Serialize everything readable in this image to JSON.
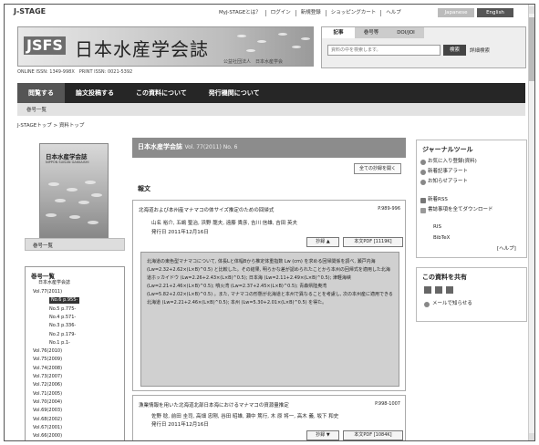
{
  "top": {
    "logo": "J-STAGE",
    "links": [
      "MyJ-STAGEとは？",
      "ログイン",
      "新規登録",
      "ショッピングカート",
      "ヘルプ"
    ],
    "lang_jp": "Japanese",
    "lang_en": "English"
  },
  "banner": {
    "abbr": "JSFS",
    "title": "日本水産学会誌",
    "subtitle": "公益社団法人　日本水産学会",
    "issn": "ONLINE ISSN: 1349-998X　PRINT ISSN: 0021-5392"
  },
  "search": {
    "tabs": [
      "記事",
      "巻号等",
      "DOI/JOI"
    ],
    "placeholder": "資料の中を検索します。",
    "button": "検索",
    "advanced": "詳細検索"
  },
  "nav": {
    "items": [
      "閲覧する",
      "論文投稿する",
      "この資料について",
      "発行機関について"
    ],
    "sub": "巻号一覧"
  },
  "breadcrumb": "J-STAGEトップ > 資料トップ",
  "cover": {
    "title": "日本水産学会誌",
    "sub": "NIPPON SUISAN GAKKAISHI"
  },
  "back_issues": "巻号一覧",
  "tree": {
    "heading": "巻号一覧",
    "sub": "日本水産学会誌",
    "nodes": [
      {
        "label": "Vol.77(2011)",
        "indent": 0
      },
      {
        "label": "No.6 p.955-",
        "indent": 1,
        "selected": true
      },
      {
        "label": "No.5 p.775-",
        "indent": 1
      },
      {
        "label": "No.4 p.571-",
        "indent": 1
      },
      {
        "label": "No.3 p.336-",
        "indent": 1
      },
      {
        "label": "No.2 p.179-",
        "indent": 1
      },
      {
        "label": "No.1 p.1-",
        "indent": 1
      },
      {
        "label": "Vol.76(2010)",
        "indent": 0
      },
      {
        "label": "Vol.75(2009)",
        "indent": 0
      },
      {
        "label": "Vol.74(2008)",
        "indent": 0
      },
      {
        "label": "Vol.73(2007)",
        "indent": 0
      },
      {
        "label": "Vol.72(2006)",
        "indent": 0
      },
      {
        "label": "Vol.71(2005)",
        "indent": 0
      },
      {
        "label": "Vol.70(2004)",
        "indent": 0
      },
      {
        "label": "Vol.69(2003)",
        "indent": 0
      },
      {
        "label": "Vol.68(2002)",
        "indent": 0
      },
      {
        "label": "Vol.67(2001)",
        "indent": 0
      },
      {
        "label": "Vol.66(2000)",
        "indent": 0
      }
    ]
  },
  "issue": {
    "journal": "日本水産学会誌",
    "vol": "Vol. 77(2011) No. 6"
  },
  "all_abstracts_btn": "全ての抄録を開く",
  "section": "報文",
  "article1": {
    "title": "北海道および本州産マナマコの体サイズ推定のための回帰式",
    "pages": "P.989-996",
    "authors": "山名 裕介, 五嶋 聖治, 浜野 龍夫, 遠藤 貴彦, 吉川 信雄, 吉田 英夫",
    "date": "発行日 2011年12月16日",
    "btn_abstract": "抄録 ▲",
    "btn_pdf": "本文PDF [1119K]",
    "abstract": "北海道の東色型マナマコについて, 体長Lと体幅Bから推定体重指数 Lw (cm) を求める回帰関係を調べ, 瀬戸内海 (Lw=2.32+2.62×(L×B)^0.5) と比較した。その結果, 明らかな差が認められたことから本州の回帰式を適用した北海道ホッカイドウ (Lw=2.26+2.43×(L×B)^0.5); 日本海 (Lw=2.11+2.49×(L×B)^0.5); 津軽海峡 (Lw=2.21+2.46×(L×B)^0.5); 噴火湾 (Lw=2.37+2.45×(L×B)^0.5); 青森県陸奥湾 (Lw=5.82+2.02×(L×B)^0.5) 。また, マナマコの形態が北海道と本州で異なることを考慮し, 次の本州産に適用できる北海道 (Lw=2.21+2.46×(L×B)^0.5); 本州 (Lw=5.30+2.01×(L×B)^0.5) を得た。"
  },
  "article2": {
    "title": "漁業情報を用いた北海道北部日本海におけるマナマコの資源量推定",
    "pages": "P.998-1007",
    "authors": "佐野 稔, 前田 圭司, 高畑 忠剛, 谷田 昭雄, 瀬中 篤行, 木 原 将一, 高木 義, 坂下 和史",
    "date": "発行日 2011年12月16日",
    "btn_abstract": "抄録 ▼",
    "btn_pdf": "本文PDF [1084K]"
  },
  "tools": {
    "heading": "ジャーナルツール",
    "items": [
      "お気に入り登録(資料)",
      "新着記事アラート",
      "お知らせアラート"
    ],
    "rss": "新着RSS",
    "download": "書誌事項を全てダウンロード",
    "formats": [
      "RIS",
      "BibTeX"
    ],
    "help": "[ヘルプ]"
  },
  "share": {
    "heading": "この資料を共有",
    "mail": "メールで知らせる"
  }
}
